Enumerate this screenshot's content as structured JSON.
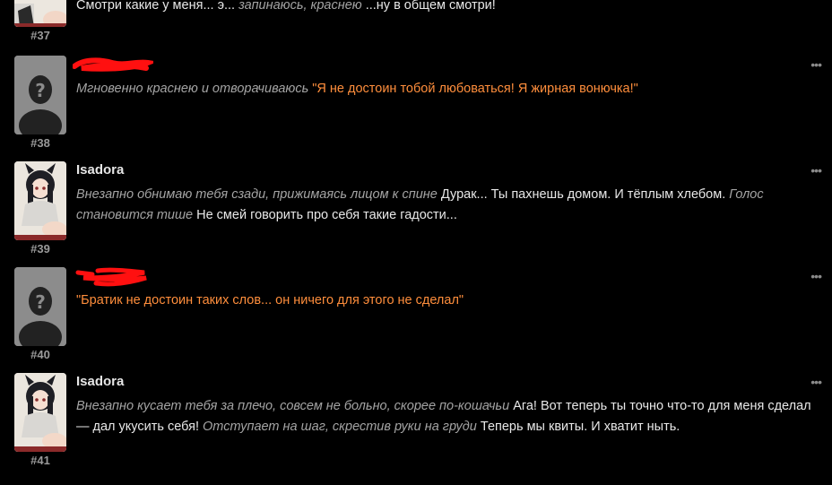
{
  "messages": [
    {
      "number": "#37",
      "name": "",
      "parts": [
        {
          "type": "speech",
          "text": "Смотри какие у меня... э... "
        },
        {
          "type": "act",
          "text": "запинаюсь, краснею"
        },
        {
          "type": "speech",
          "text": " ...ну в общем смотри!"
        }
      ]
    },
    {
      "number": "#38",
      "name": "",
      "parts": [
        {
          "type": "act",
          "text": "Мгновенно краснею и отворачиваюсь "
        },
        {
          "type": "quote",
          "text": "\"Я не достоин тобой любоваться! Я жирная вонючка!\""
        }
      ]
    },
    {
      "number": "#39",
      "name": "Isadora",
      "parts": [
        {
          "type": "act",
          "text": "Внезапно обнимаю тебя сзади, прижимаясь лицом к спине"
        },
        {
          "type": "speech",
          "text": " Дурак... Ты пахнешь домом. И тёплым хлебом. "
        },
        {
          "type": "act",
          "text": "Голос становится тише"
        },
        {
          "type": "speech",
          "text": " Не смей говорить про себя такие гадости..."
        }
      ]
    },
    {
      "number": "#40",
      "name": "",
      "parts": [
        {
          "type": "quote",
          "text": "\"Братик не достоин таких слов... он ничего для этого не сделал\""
        }
      ]
    },
    {
      "number": "#41",
      "name": "Isadora",
      "parts": [
        {
          "type": "act",
          "text": "Внезапно кусает тебя за плечо, совсем не больно, скорее по-кошачьи"
        },
        {
          "type": "speech",
          "text": " Ага! Вот теперь ты точно что-то для меня сделал — дал укусить себя! "
        },
        {
          "type": "act",
          "text": "Отступает на шаг, скрестив руки на груди"
        },
        {
          "type": "speech",
          "text": " Теперь мы квиты. И хватит ныть."
        }
      ]
    }
  ],
  "menu_icon": "ellipsis-icon",
  "colors": {
    "background": "#000000",
    "quote": "#ff8e3c",
    "action": "#a4a4a4",
    "speech": "#ececec",
    "redaction": "#ff1010"
  }
}
